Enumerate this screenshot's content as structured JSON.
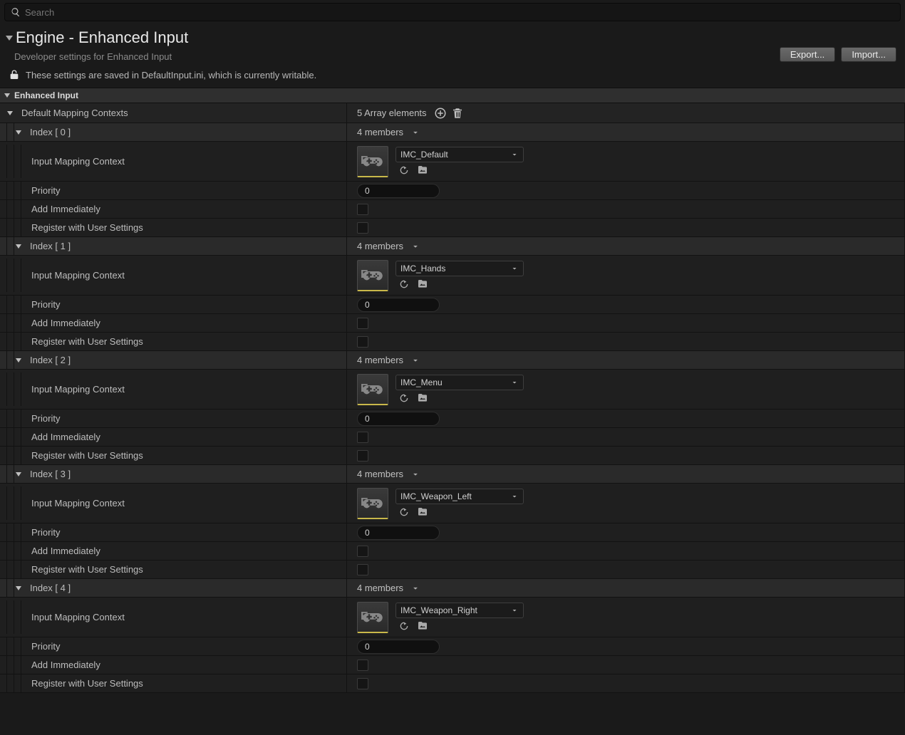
{
  "search": {
    "placeholder": "Search"
  },
  "header": {
    "title": "Engine - Enhanced Input",
    "subtitle": "Developer settings for Enhanced Input",
    "export_label": "Export...",
    "import_label": "Import..."
  },
  "lock_message": "These settings are saved in DefaultInput.ini, which is currently writable.",
  "section_title": "Enhanced Input",
  "array_header": {
    "label": "Default Mapping Contexts",
    "count_text": "5 Array elements"
  },
  "labels": {
    "index_prefix": "Index",
    "members_text": "4 members",
    "input_mapping_context": "Input Mapping Context",
    "priority": "Priority",
    "add_immediately": "Add Immediately",
    "register_with_user_settings": "Register with User Settings"
  },
  "entries": [
    {
      "index": "0",
      "asset": "IMC_Default",
      "priority": "0",
      "add_immediately": false,
      "register": false
    },
    {
      "index": "1",
      "asset": "IMC_Hands",
      "priority": "0",
      "add_immediately": false,
      "register": false
    },
    {
      "index": "2",
      "asset": "IMC_Menu",
      "priority": "0",
      "add_immediately": false,
      "register": false
    },
    {
      "index": "3",
      "asset": "IMC_Weapon_Left",
      "priority": "0",
      "add_immediately": false,
      "register": false
    },
    {
      "index": "4",
      "asset": "IMC_Weapon_Right",
      "priority": "0",
      "add_immediately": false,
      "register": false
    }
  ]
}
